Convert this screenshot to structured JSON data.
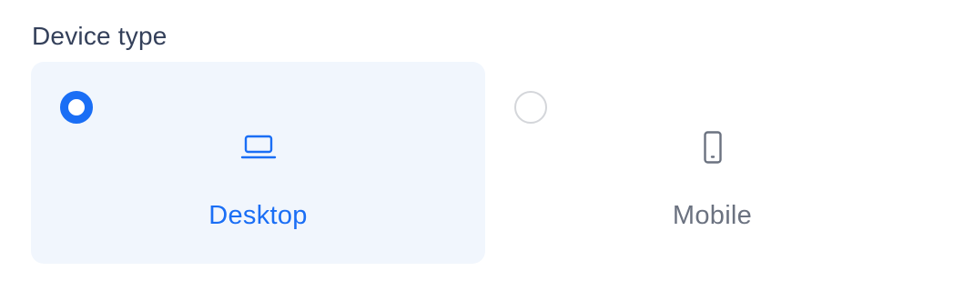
{
  "device_type": {
    "label": "Device type",
    "options": [
      {
        "label": "Desktop",
        "icon": "laptop-icon",
        "selected": true
      },
      {
        "label": "Mobile",
        "icon": "mobile-phone-icon",
        "selected": false
      }
    ]
  },
  "colors": {
    "accent": "#1a6ef5",
    "selected_bg": "#f1f6fd",
    "label_text": "#34405a",
    "muted_text": "#6b7280",
    "radio_border": "#d4d6da"
  }
}
